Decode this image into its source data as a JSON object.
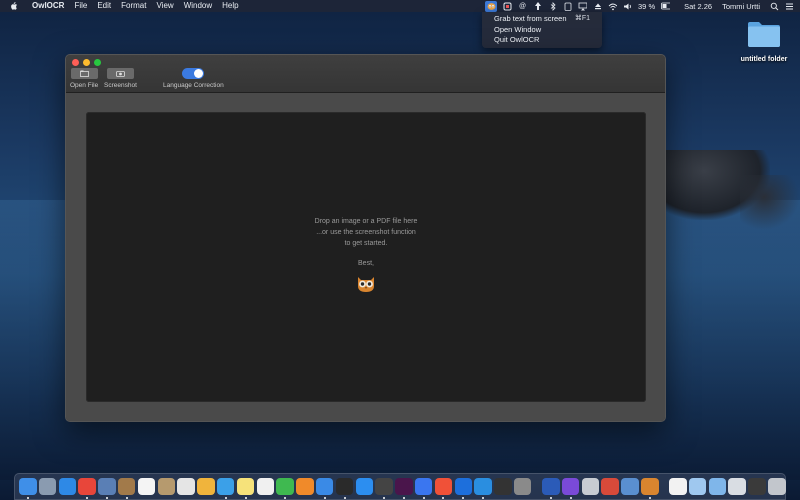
{
  "menubar": {
    "app_name": "OwlOCR",
    "items": [
      "File",
      "Edit",
      "Format",
      "View",
      "Window",
      "Help"
    ],
    "battery": "39 %",
    "clock": "Sat 2.26",
    "user": "Tommi Urtti"
  },
  "status_menu": {
    "items": [
      {
        "label": "Grab text from screen",
        "shortcut": "⌘F1"
      },
      {
        "label": "Open Window",
        "shortcut": ""
      },
      {
        "label": "Quit OwlOCR",
        "shortcut": ""
      }
    ]
  },
  "desktop": {
    "folder_label": "untitled folder"
  },
  "window": {
    "toolbar": {
      "open_file_label": "Open File",
      "screenshot_label": "Screenshot",
      "language_correction_label": "Language Correction",
      "language_correction_on": true
    },
    "drop_zone": {
      "line1": "Drop an image or a PDF file here",
      "line2": "...or use the screenshot function",
      "line3": "to get started.",
      "signoff": "Best,"
    }
  },
  "dock": {
    "apps": [
      {
        "icon": "finder-icon",
        "color": "#3f8fe8"
      },
      {
        "icon": "launchpad-icon",
        "color": "#8a9bb0"
      },
      {
        "icon": "safari-icon",
        "color": "#2e89e6"
      },
      {
        "icon": "chrome-icon",
        "color": "#e8463a"
      },
      {
        "icon": "preview-icon",
        "color": "#5a7fb5"
      },
      {
        "icon": "notes-brown-icon",
        "color": "#a27a4a"
      },
      {
        "icon": "calendar-icon",
        "color": "#f4f4f4"
      },
      {
        "icon": "contacts-icon",
        "color": "#b69a6e"
      },
      {
        "icon": "preview-photos-icon",
        "color": "#e5e5e5"
      },
      {
        "icon": "photos-icon",
        "color": "#f0b43c"
      },
      {
        "icon": "messages-blue-icon",
        "color": "#3ba0e8"
      },
      {
        "icon": "notes-icon",
        "color": "#f6e27a"
      },
      {
        "icon": "pages-icon",
        "color": "#f0f0f0"
      },
      {
        "icon": "numbers-icon",
        "color": "#3fb950"
      },
      {
        "icon": "books-icon",
        "color": "#f08a2a"
      },
      {
        "icon": "keynote-icon",
        "color": "#3a8ae6"
      },
      {
        "icon": "terminal-icon",
        "color": "#2a2a2a"
      },
      {
        "icon": "app-store-icon",
        "color": "#2c8ef0"
      },
      {
        "icon": "activity-monitor-icon",
        "color": "#444"
      },
      {
        "icon": "slack-icon",
        "color": "#4a154b"
      },
      {
        "icon": "signal-icon",
        "color": "#3a76f0"
      },
      {
        "icon": "swift-icon",
        "color": "#f05138"
      },
      {
        "icon": "xcode-icon",
        "color": "#1d6fdc"
      },
      {
        "icon": "vscode-icon",
        "color": "#2a8ee0"
      },
      {
        "icon": "instruments-icon",
        "color": "#333"
      },
      {
        "icon": "console-icon",
        "color": "#8a8a8a"
      }
    ],
    "apps2": [
      {
        "icon": "word-icon",
        "color": "#2b5bb8"
      },
      {
        "icon": "imovie-icon",
        "color": "#7a4ad8"
      },
      {
        "icon": "scanner-icon",
        "color": "#c8ccd2"
      },
      {
        "icon": "photo-booth-icon",
        "color": "#d84a3a"
      },
      {
        "icon": "filemerge-icon",
        "color": "#5a8fd0"
      },
      {
        "icon": "owlocr-icon",
        "color": "#d9852f"
      }
    ],
    "folders": [
      {
        "icon": "document-icon",
        "color": "#f2f2f2"
      },
      {
        "icon": "folder-icon",
        "color": "#9fc8ef"
      },
      {
        "icon": "folder-downloads-icon",
        "color": "#7fb6ea"
      },
      {
        "icon": "screenshot-icon",
        "color": "#d9dde3"
      },
      {
        "icon": "terminal-doc-icon",
        "color": "#3a3a3a"
      },
      {
        "icon": "trash-icon",
        "color": "#c2c6cc"
      }
    ]
  }
}
